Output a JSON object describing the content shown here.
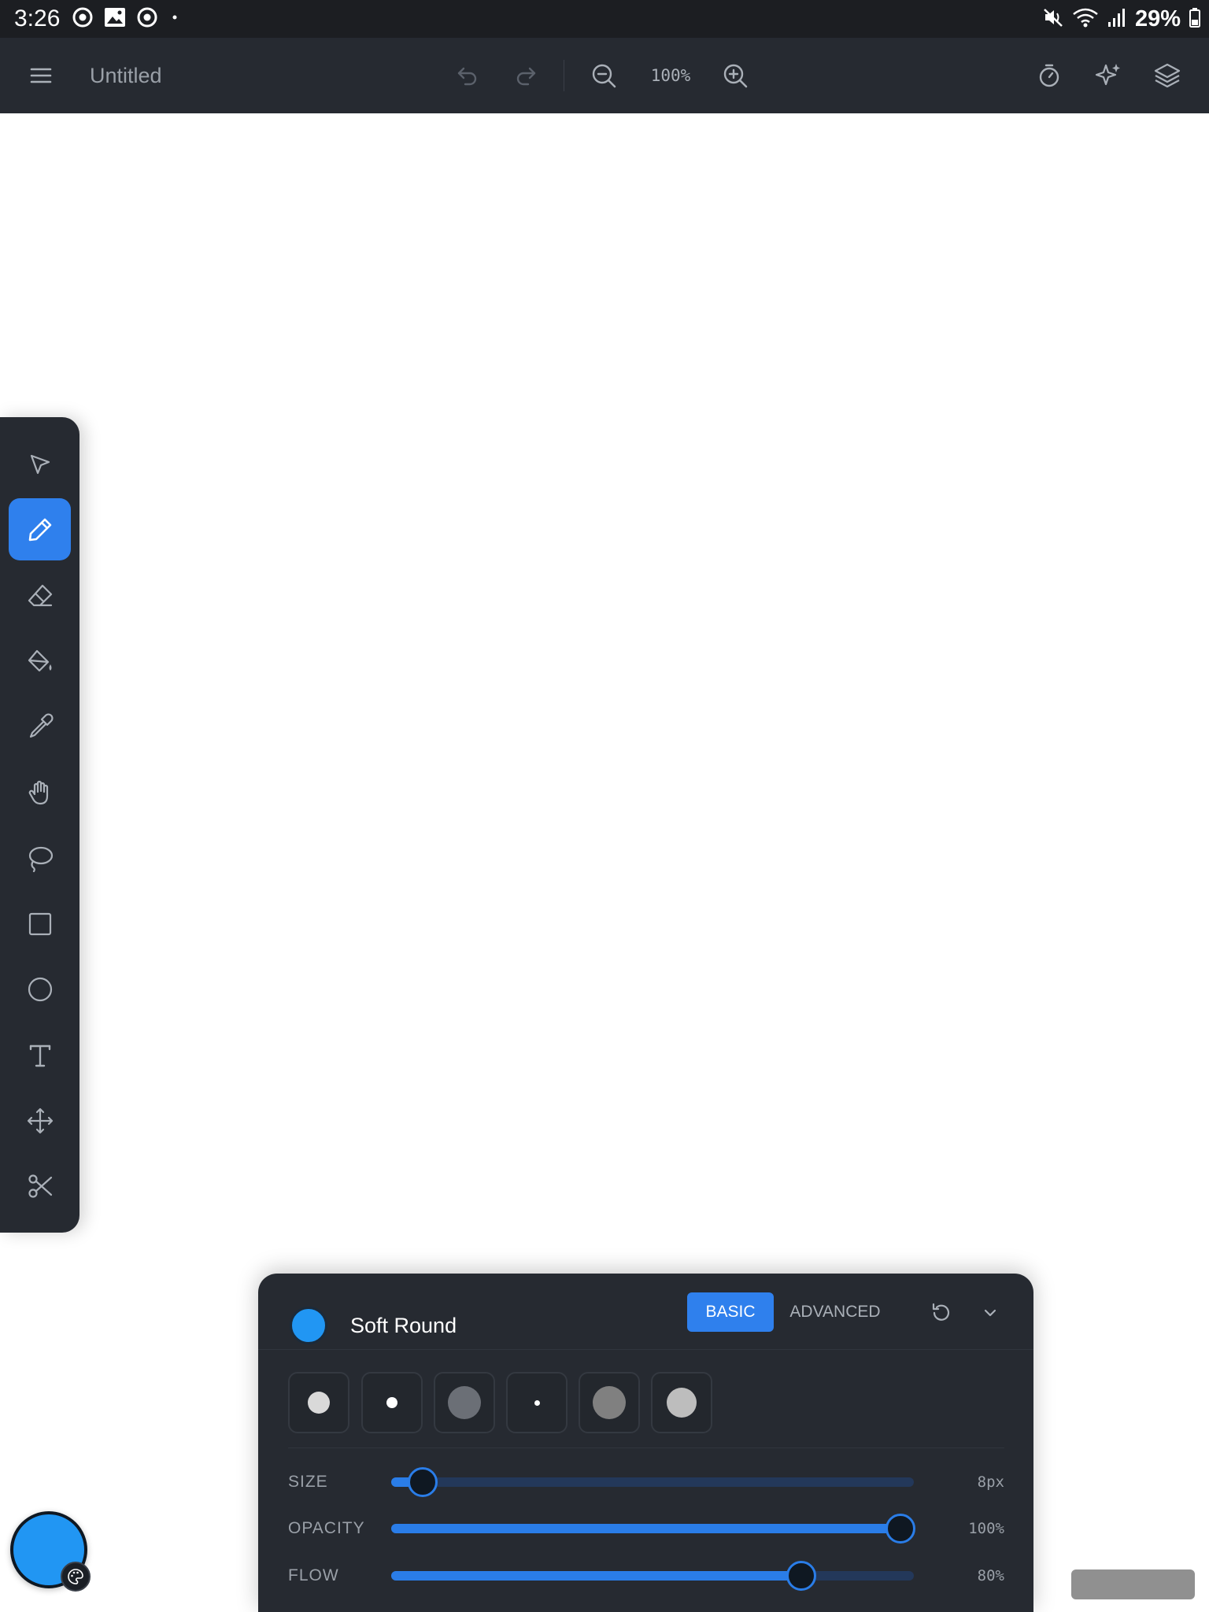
{
  "status_bar": {
    "time": "3:26",
    "battery": "29%"
  },
  "app_bar": {
    "title": "Untitled",
    "zoom": "100%"
  },
  "tools": [
    {
      "id": "select",
      "active": false
    },
    {
      "id": "brush",
      "active": true
    },
    {
      "id": "eraser",
      "active": false
    },
    {
      "id": "fill",
      "active": false
    },
    {
      "id": "eyedropper",
      "active": false
    },
    {
      "id": "hand",
      "active": false
    },
    {
      "id": "lasso",
      "active": false
    },
    {
      "id": "rectangle",
      "active": false
    },
    {
      "id": "ellipse",
      "active": false
    },
    {
      "id": "text",
      "active": false
    },
    {
      "id": "move",
      "active": false
    },
    {
      "id": "scissors",
      "active": false
    }
  ],
  "brush_panel": {
    "brush_name": "Soft Round",
    "brush_color": "#2196f3",
    "tab_basic": "BASIC",
    "tab_advanced": "ADVANCED",
    "active_tab": "BASIC",
    "presets": [
      {
        "dot_color": "#d9d9d9",
        "dot_size": "medium"
      },
      {
        "dot_color": "#ffffff",
        "dot_size": "small"
      },
      {
        "dot_color": "#6b6f76",
        "dot_size": "large"
      },
      {
        "dot_color": "#ffffff",
        "dot_size": "tiny"
      },
      {
        "dot_color": "#808080",
        "dot_size": "large"
      },
      {
        "dot_color": "#bdbdbd",
        "dot_size": "large"
      }
    ],
    "sliders": [
      {
        "label": "SIZE",
        "value": "8px",
        "level": 0.06
      },
      {
        "label": "OPACITY",
        "value": "100%",
        "level": 0.975
      },
      {
        "label": "FLOW",
        "value": "80%",
        "level": 0.785
      }
    ]
  },
  "current_color": "#2196f3",
  "accent_color": "#2f80ed"
}
